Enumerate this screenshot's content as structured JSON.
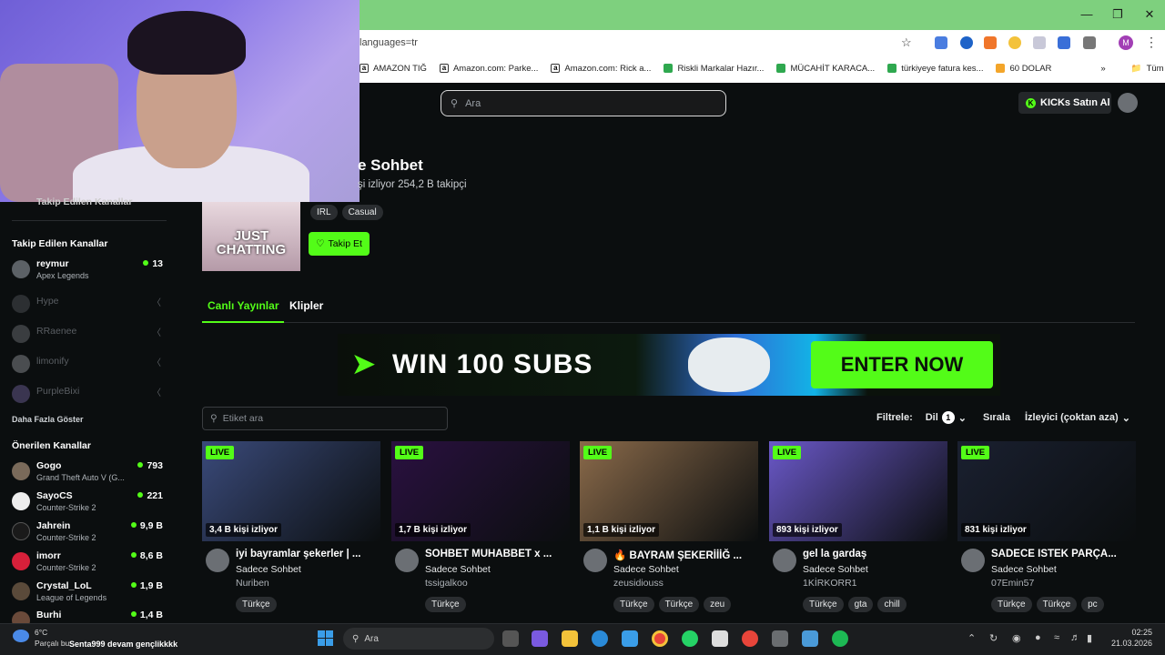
{
  "browser": {
    "url": "languages=tr",
    "bookmarks": [
      "AMAZON TIĞ",
      "Amazon.com: Parke...",
      "Amazon.com: Rick a...",
      "Riskli Markalar Hazır...",
      "MÜCAHİT KARACA...",
      "türkiyeye fatura kes...",
      "60 DOLAR"
    ],
    "all_bookmarks": "Tüm Yer İşaretleri",
    "profile_initial": "M"
  },
  "header": {
    "search_placeholder": "Ara",
    "kicks_label": "KICKs Satın Al"
  },
  "sidebar": {
    "partial_heading": "Takip Edilen Kanallar",
    "followed_heading": "Takip Edilen Kanallar",
    "followed": [
      {
        "name": "reymur",
        "game": "Apex Legends",
        "count": "13",
        "online": true
      },
      {
        "name": "Hype",
        "online": false
      },
      {
        "name": "RRaenee",
        "online": false
      },
      {
        "name": "limonify",
        "online": false
      },
      {
        "name": "PurpleBixi",
        "online": false
      }
    ],
    "show_more": "Daha Fazla Göster",
    "recommended_heading": "Önerilen Kanallar",
    "recommended": [
      {
        "name": "Gogo",
        "game": "Grand Theft Auto V (G...",
        "count": "793"
      },
      {
        "name": "SayoCS",
        "game": "Counter-Strike 2",
        "count": "221"
      },
      {
        "name": "Jahrein",
        "game": "Counter-Strike 2",
        "count": "9,9 B"
      },
      {
        "name": "imorr",
        "game": "Counter-Strike 2",
        "count": "8,6 B"
      },
      {
        "name": "Crystal_LoL",
        "game": "League of Legends",
        "count": "1,9 B"
      },
      {
        "name": "Burhi",
        "count": "1,4 B"
      }
    ]
  },
  "category": {
    "title": "e Sohbet",
    "meta": "şi izliyor  254,2 B takipçi",
    "thumb_text": "JUST CHATTING",
    "tags": [
      "IRL",
      "Casual"
    ],
    "follow_label": "Takip Et"
  },
  "tabs": {
    "live": "Canlı Yayınlar",
    "clips": "Klipler"
  },
  "banner": {
    "headline": "WIN 100 SUBS",
    "cta": "ENTER NOW"
  },
  "filters": {
    "tag_search_placeholder": "Etiket ara",
    "filter_label": "Filtrele:",
    "lang_label": "Dil",
    "lang_count": "1",
    "sort_label": "Sırala",
    "sort_value": "İzleyici (çoktan aza)"
  },
  "streams": [
    {
      "live": "LIVE",
      "viewers": "3,4 B kişi izliyor",
      "title": "iyi bayramlar şekerler | ...",
      "category": "Sadece Sohbet",
      "user": "Nuriben",
      "tags": [
        "Türkçe"
      ],
      "thumb": "#3a4a7a"
    },
    {
      "live": "LIVE",
      "viewers": "1,7 B kişi izliyor",
      "title": "SOHBET MUHABBET x ...",
      "category": "Sadece Sohbet",
      "user": "tssigalkoo",
      "tags": [
        "Türkçe"
      ],
      "thumb": "#2a1140"
    },
    {
      "live": "LIVE",
      "viewers": "1,1 B kişi izliyor",
      "title": "🔥 BAYRAM ŞEKERİİİĞ ...",
      "category": "Sadece Sohbet",
      "user": "zeusidiouss",
      "tags": [
        "Türkçe",
        "Türkçe",
        "zeu"
      ],
      "thumb": "#8a6a4a"
    },
    {
      "live": "LIVE",
      "viewers": "893 kişi izliyor",
      "title": "gel la gardaş",
      "category": "Sadece Sohbet",
      "user": "1KİRKORR1",
      "tags": [
        "Türkçe",
        "gta",
        "chill"
      ],
      "thumb": "#6a58c8"
    },
    {
      "live": "LIVE",
      "viewers": "831 kişi izliyor",
      "title": "SADECE İSTEK PARÇA...",
      "category": "Sadece Sohbet",
      "user": "07Emin57",
      "tags": [
        "Türkçe",
        "Türkçe",
        "pc"
      ],
      "thumb": "#1a2030"
    }
  ],
  "taskbar": {
    "temp": "6°C",
    "weather": "Parçalı bu",
    "ticker": "Senta999  devam gençlikkkk",
    "search": "Ara",
    "time": "02:25",
    "date": "21.03.2026"
  }
}
